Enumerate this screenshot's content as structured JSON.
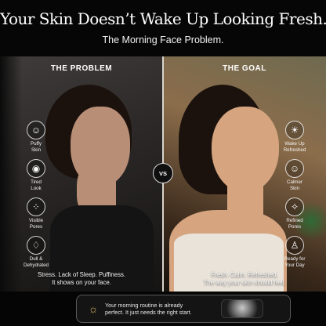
{
  "header": {
    "title": "Your Skin Doesn’t Wake Up Looking Fresh.",
    "subtitle": "The Morning Face Problem."
  },
  "problem": {
    "heading": "THE PROBLEM",
    "items": [
      {
        "icon": "face-icon",
        "label": "Puffy\nSkin"
      },
      {
        "icon": "eye-icon",
        "label": "Tired\nLook"
      },
      {
        "icon": "pores-icon",
        "label": "Visible\nPores"
      },
      {
        "icon": "droplet-icon",
        "label": "Dull &\nDehydrated"
      }
    ],
    "caption": "Stress. Lack of Sleep. Puffiness.\nIt shows on your face."
  },
  "goal": {
    "heading": "THE GOAL",
    "items": [
      {
        "icon": "sun-icon",
        "label": "Wake Up\nRefreshed"
      },
      {
        "icon": "calm-face-icon",
        "label": "Calmer\nSkin"
      },
      {
        "icon": "sparkle-icon",
        "label": "Refined\nPores"
      },
      {
        "icon": "person-icon",
        "label": "Ready for\nYour Day"
      }
    ],
    "caption": "Fresh. Calm. Refreshed.\nThe way your skin should feel."
  },
  "vs_label": "VS",
  "cta": {
    "text": "Your morning routine is already\nperfect. It just needs the right start."
  }
}
